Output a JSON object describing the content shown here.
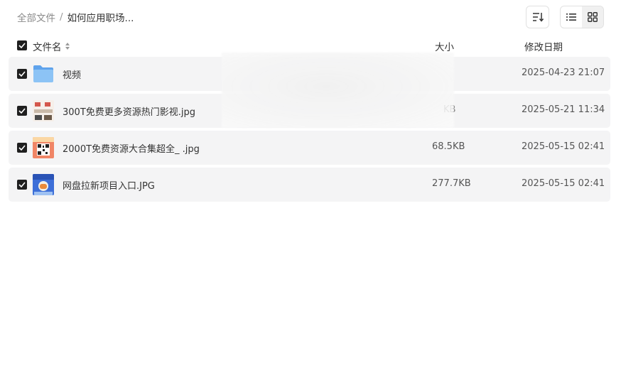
{
  "breadcrumb": {
    "root": "全部文件",
    "separator": "/",
    "current": "如何应用职场..."
  },
  "toolbar": {
    "sort_icon": "sort-icon",
    "list_view_icon": "list-view-icon",
    "grid_view_icon": "grid-view-icon"
  },
  "table": {
    "columns": {
      "name": "文件名",
      "size": "大小",
      "date": "修改日期"
    },
    "rows": [
      {
        "name": "视频",
        "size": "",
        "date": "2025-04-23 21:07",
        "type": "folder",
        "checked": true
      },
      {
        "name": "300T免费更多资源热门影视.jpg",
        "size": "KB",
        "date": "2025-05-21 11:34",
        "type": "image",
        "checked": true
      },
      {
        "name": "2000T免费资源大合集超全_ .jpg",
        "size": "68.5KB",
        "date": "2025-05-15 02:41",
        "type": "image",
        "checked": true
      },
      {
        "name": "网盘拉新项目入口.JPG",
        "size": "277.7KB",
        "date": "2025-05-15 02:41",
        "type": "image",
        "checked": true
      }
    ]
  },
  "colors": {
    "row_background": "#f4f4f5",
    "checkbox": "#1f1f1f",
    "folder": "#7cb8f2",
    "muted_text": "#8a8a8a"
  }
}
